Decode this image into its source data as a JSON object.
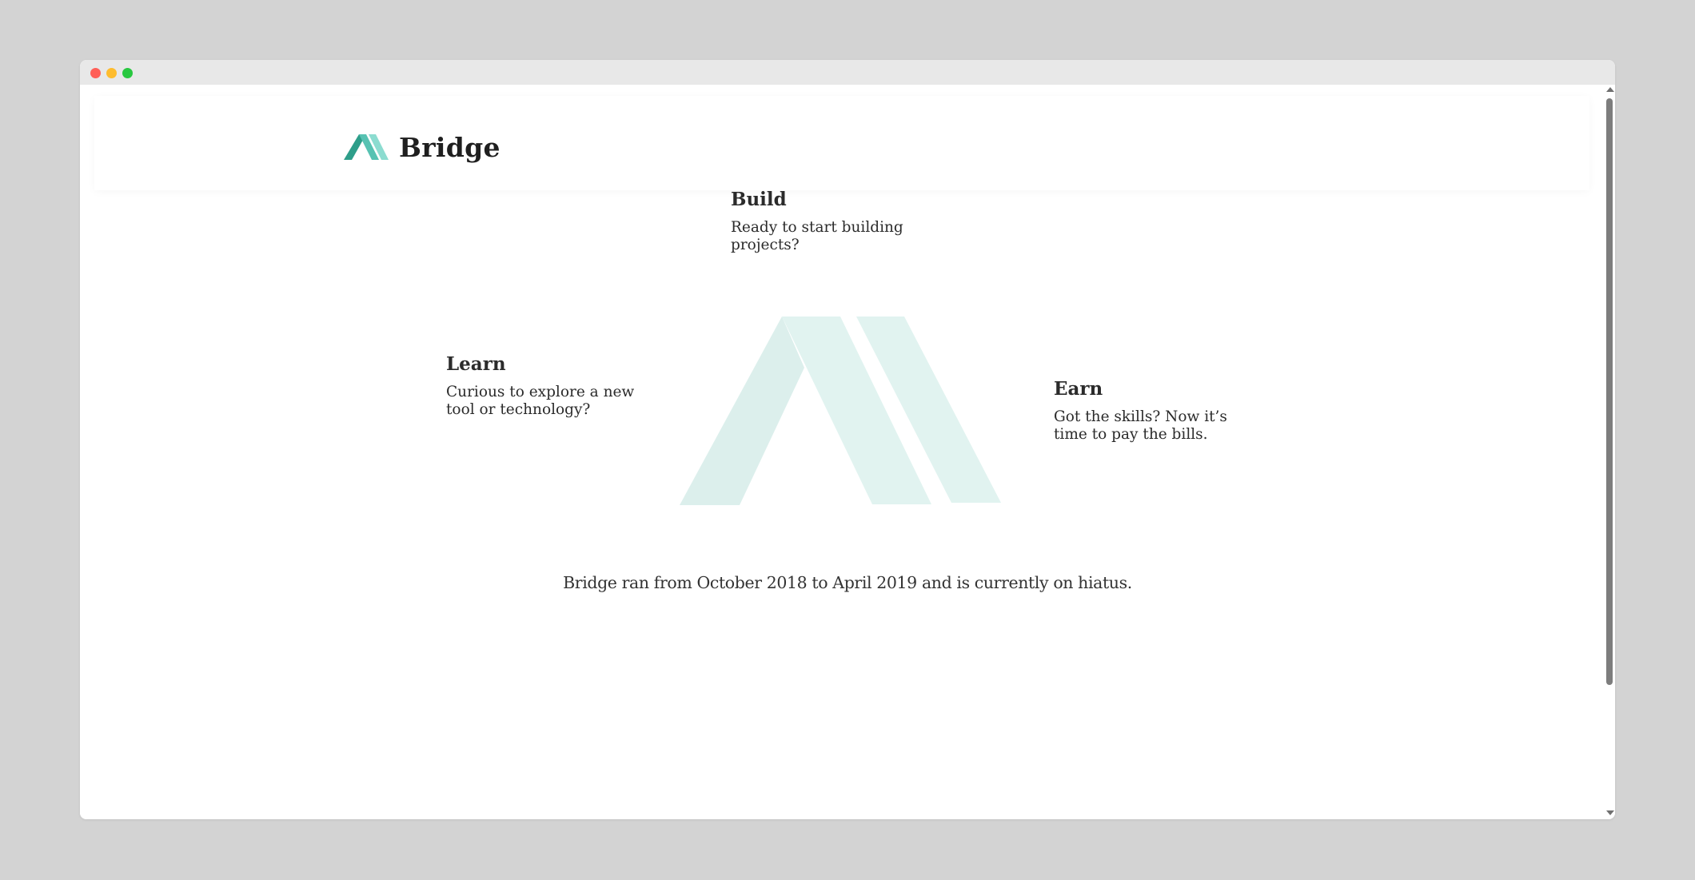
{
  "brand": {
    "name": "Bridge",
    "accent_dark": "#2e9e8a",
    "accent_light": "#7fd6c8"
  },
  "cards": {
    "build": {
      "title": "Build",
      "text": "Ready to start building projects?"
    },
    "learn": {
      "title": "Learn",
      "text": "Curious to explore a new tool or technology?"
    },
    "earn": {
      "title": "Earn",
      "text": "Got the skills? Now it’s time to pay the bills."
    }
  },
  "hero": {
    "icon": "bridge-logo-icon",
    "color": "#dcefec"
  },
  "footer": {
    "hiatus_text": "Bridge ran from October 2018 to April 2019 and is currently on hiatus."
  },
  "window": {
    "controls": [
      "close",
      "minimize",
      "maximize"
    ]
  }
}
